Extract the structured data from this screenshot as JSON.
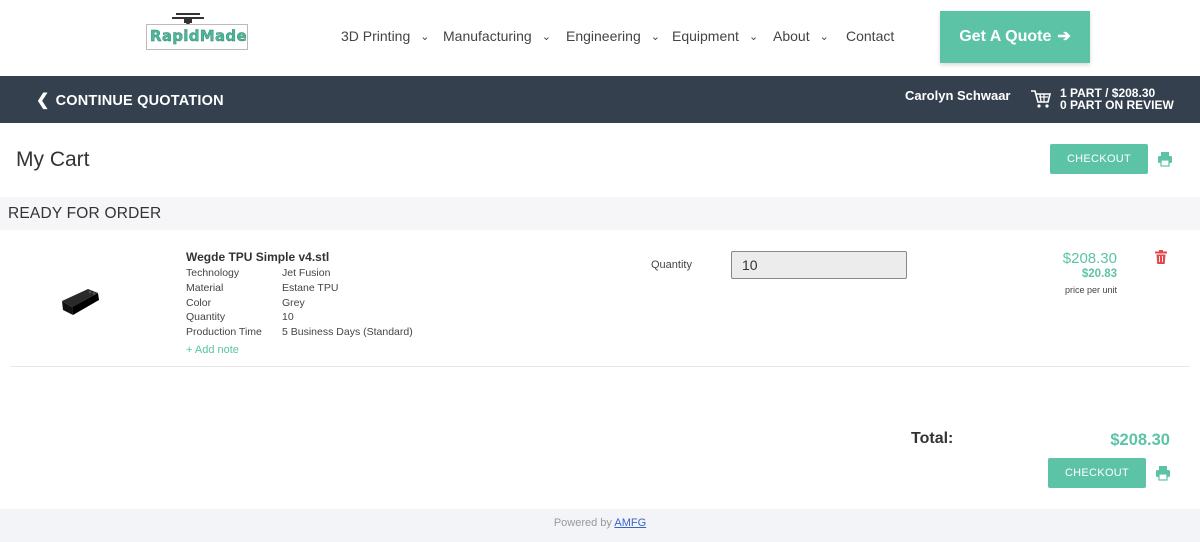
{
  "brand": {
    "logo_text": "RapidMade"
  },
  "nav": {
    "items": [
      {
        "label": "3D Printing",
        "has_dropdown": true
      },
      {
        "label": "Manufacturing",
        "has_dropdown": true
      },
      {
        "label": "Engineering",
        "has_dropdown": true
      },
      {
        "label": "Equipment",
        "has_dropdown": true
      },
      {
        "label": "About",
        "has_dropdown": true
      },
      {
        "label": "Contact",
        "has_dropdown": false
      }
    ],
    "cta_label": "Get A Quote",
    "cta_icon": "arrow-right-icon"
  },
  "quotebar": {
    "continue_label": "CONTINUE QUOTATION",
    "user_name": "Carolyn Schwaar",
    "cart_line1": "1 PART / $208.30",
    "cart_line2": "0 PART ON REVIEW"
  },
  "cart": {
    "title": "My Cart",
    "checkout_label": "CHECKOUT",
    "section_label": "READY FOR ORDER",
    "items": [
      {
        "name": "Wegde TPU Simple v4.stl",
        "specs": [
          {
            "key": "Technology",
            "value": "Jet Fusion"
          },
          {
            "key": "Material",
            "value": "Estane TPU"
          },
          {
            "key": "Color",
            "value": "Grey"
          },
          {
            "key": "Quantity",
            "value": "10"
          },
          {
            "key": "Production Time",
            "value": "5 Business Days (Standard)"
          }
        ],
        "add_note_label": "+ Add note",
        "quantity_label": "Quantity",
        "quantity_value": "10",
        "price_total": "$208.30",
        "price_unit": "$20.83",
        "price_caption": "price per unit"
      }
    ],
    "total_label": "Total:",
    "total_value": "$208.30"
  },
  "footer": {
    "powered_prefix": "Powered by",
    "powered_link": "AMFG"
  },
  "colors": {
    "accent": "#5cc3a7",
    "dark_bar": "#34404e",
    "danger": "#e04848",
    "link": "#3a63c9"
  }
}
